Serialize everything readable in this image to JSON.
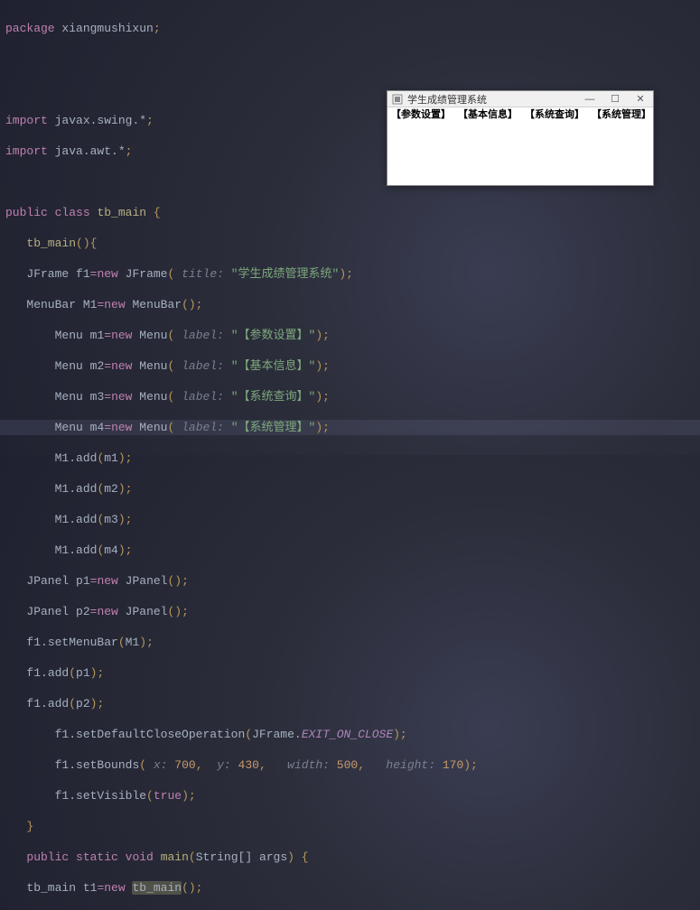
{
  "code": {
    "package_kw": "package",
    "package_name": "xiangmushixun",
    "import_kw": "import",
    "import1": "javax.swing.*",
    "import2": "java.awt.*",
    "public_kw": "public",
    "class_kw": "class",
    "class_name": "tb_main",
    "ctor_name": "tb_main",
    "new_kw": "new",
    "jframe": "JFrame",
    "jframe_var": "f1",
    "jframe_title_param": "title:",
    "jframe_title_str": "\"学生成绩管理系统\"",
    "menubar": "MenuBar",
    "menubar_var": "M1",
    "menu": "Menu",
    "m1": "m1",
    "m2": "m2",
    "m3": "m3",
    "m4": "m4",
    "label_param": "label:",
    "menu1_str": "\"【参数设置】\"",
    "menu2_str": "\"【基本信息】\"",
    "menu3_str": "\"【系统查询】\"",
    "menu4_str": "\"【系统管理】\"",
    "add": "add",
    "jpanel": "JPanel",
    "p1": "p1",
    "p2": "p2",
    "setMenuBar": "setMenuBar",
    "setDefaultCloseOperation": "setDefaultCloseOperation",
    "exit_const": "EXIT_ON_CLOSE",
    "setBounds": "setBounds",
    "x_param": "x:",
    "y_param": "y:",
    "w_param": "width:",
    "h_param": "height:",
    "x_val": "700",
    "y_val": "430",
    "w_val": "500",
    "h_val": "170",
    "setVisible": "setVisible",
    "true_kw": "true",
    "static_kw": "static",
    "void_kw": "void",
    "main_name": "main",
    "string_arr": "String[]",
    "args": "args",
    "t1": "t1"
  },
  "window": {
    "title": "学生成绩管理系统",
    "menu1": "【参数设置】",
    "menu2": "【基本信息】",
    "menu3": "【系统查询】",
    "menu4": "【系统管理】",
    "min": "—",
    "max": "☐",
    "close": "✕"
  }
}
